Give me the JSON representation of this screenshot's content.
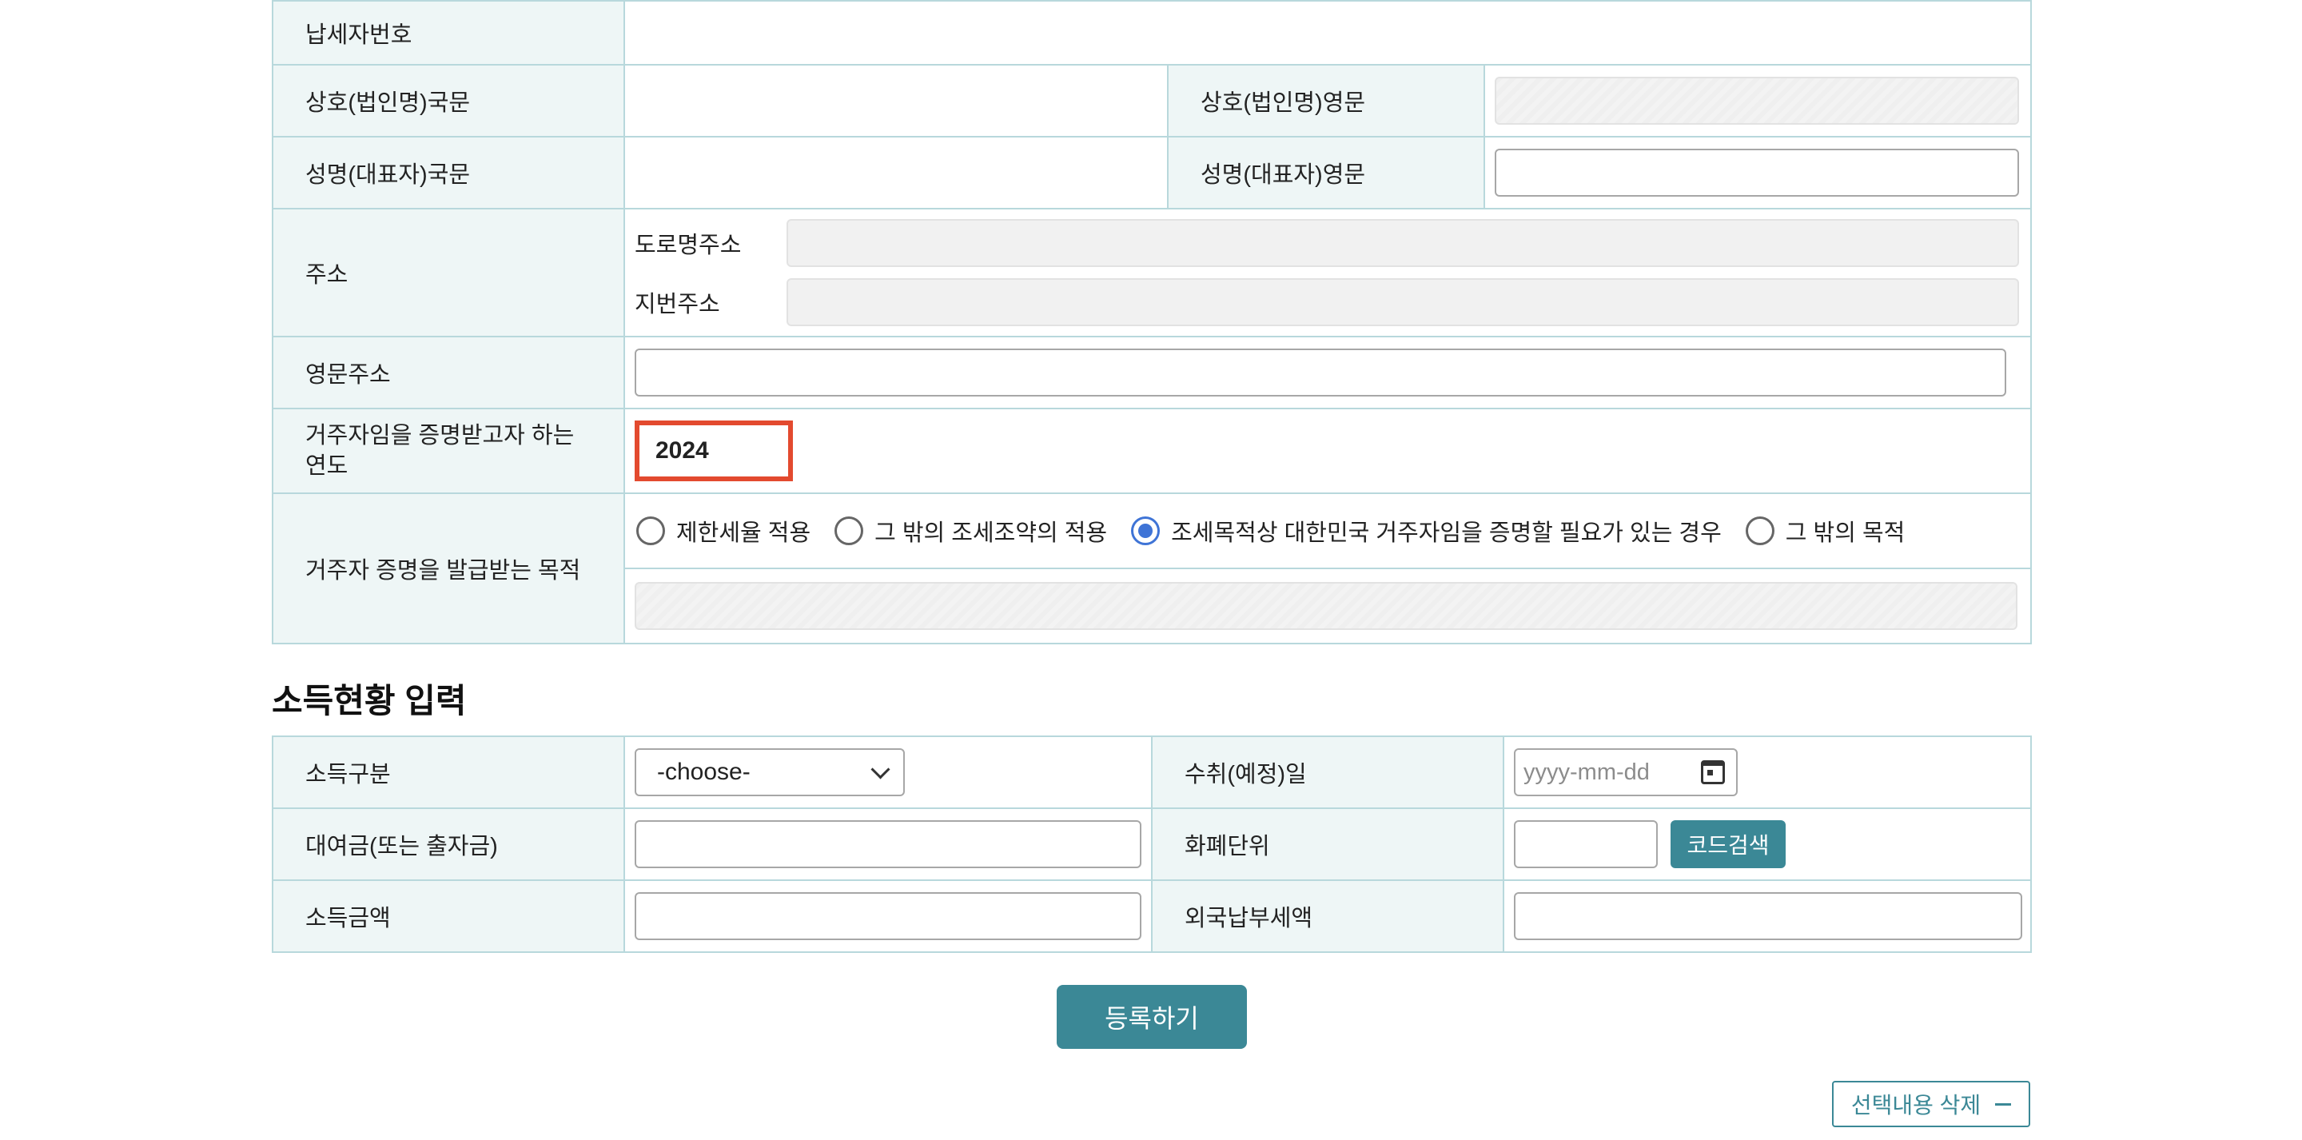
{
  "taxpayer": {
    "id_label": "납세자번호",
    "trade_name_kr_label": "상호(법인명)국문",
    "trade_name_en_label": "상호(법인명)영문",
    "rep_name_kr_label": "성명(대표자)국문",
    "rep_name_en_label": "성명(대표자)영문",
    "address_label": "주소",
    "road_address_label": "도로명주소",
    "lot_address_label": "지번주소",
    "english_address_label": "영문주소",
    "year_label_line1": "거주자임을 증명받고자 하는",
    "year_label_line2": "연도",
    "year_value": "2024",
    "purpose_label": "거주자 증명을 발급받는 목적",
    "purpose_options": [
      {
        "label": "제한세율 적용",
        "selected": false
      },
      {
        "label": "그 밖의 조세조약의 적용",
        "selected": false
      },
      {
        "label": "조세목적상 대한민국 거주자임을 증명할 필요가 있는 경우",
        "selected": true
      },
      {
        "label": "그 밖의 목적",
        "selected": false
      }
    ]
  },
  "income": {
    "section_title": "소득현황 입력",
    "type_label": "소득구분",
    "type_select_value": "-choose-",
    "receipt_date_label": "수취(예정)일",
    "receipt_date_placeholder": "yyyy-mm-dd",
    "loan_label": "대여금(또는 출자금)",
    "currency_label": "화폐단위",
    "code_search_button": "코드검색",
    "income_amount_label": "소득금액",
    "foreign_tax_label": "외국납부세액"
  },
  "actions": {
    "register_button": "등록하기",
    "delete_selected_button": "선택내용 삭제"
  },
  "colors": {
    "accent": "#3b8896",
    "header_cell_bg": "#eef6f6",
    "border": "#b8d8dc",
    "highlight_red": "#e34a2f",
    "radio_selected": "#3f74d6"
  }
}
